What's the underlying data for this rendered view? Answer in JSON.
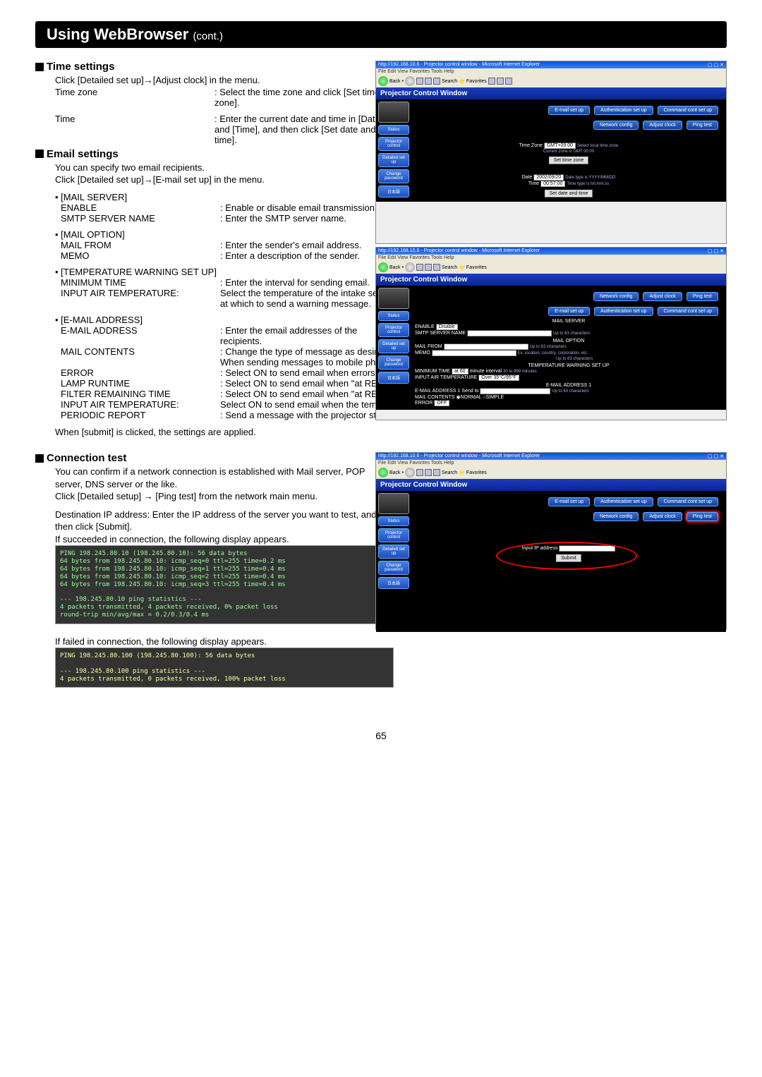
{
  "title": "Using WebBrowser",
  "title_cont": "(cont.)",
  "s1": {
    "heading": "Time settings",
    "intro": "Click [Detailed set up]→[Adjust clock] in the menu.",
    "timezone_lbl": "Time zone",
    "timezone_desc": ": Select the time zone and click [Set time zone].",
    "time_lbl": "Time",
    "time_desc": ": Enter the current date and time in [Date] and [Time], and then click [Set date and time]."
  },
  "s2": {
    "heading": "Email settings",
    "line1": "You can specify two email recipients.",
    "line2": "Click [Detailed set up]→[E-mail set up] in the menu.",
    "mail_server": "• [MAIL SERVER]",
    "enable_lbl": "ENABLE",
    "enable_desc": ": Enable or disable email transmission.",
    "smtp_lbl": "SMTP SERVER NAME",
    "smtp_desc": ": Enter the SMTP server name.",
    "mail_option": "• [MAIL OPTION]",
    "mailfrom_lbl": "MAIL FROM",
    "mailfrom_desc": ": Enter the sender's email address.",
    "memo_lbl": "MEMO",
    "memo_desc": ": Enter a description of the sender.",
    "temp_warn": "• [TEMPERATURE WARNING SET UP]",
    "mintime_lbl": "MINIMUM TIME",
    "mintime_desc": ": Enter the interval for sending email.",
    "inair_lbl": "INPUT AIR TEMPERATURE:",
    "inair_desc": "Select the temperature of the intake sensor at which to send a warning message.",
    "email_addr": "• [E-MAIL ADDRESS]",
    "ea_lbl": "E-MAIL ADDRESS",
    "ea_desc": ": Enter the email addresses of the recipients.",
    "mc_lbl": "MAIL CONTENTS",
    "mc_desc": ": Change the type of message as desired.",
    "mc_desc2": "When sending messages to mobile phones, select \"SIMPLE.\"",
    "err_lbl": "ERROR",
    "err_desc": ": Select ON to send email when errors occur.",
    "lamp_lbl": "LAMP RUNTIME",
    "lamp_desc": ": Select ON to send email when \"at REMAIN\" is reached.",
    "fr_lbl": "FILTER REMAINING TIME",
    "fr_desc": ": Select ON to send email when \"at REMAIN\" is reached.",
    "iat_lbl": "INPUT AIR TEMPERATURE:",
    "iat_desc": "Select ON to send email when the temperature set in [TEMPERATURE WARNING SET UP] is exceeded.",
    "pr_lbl": "PERIODIC REPORT",
    "pr_desc": ": Send a message with the projector status at the selected date and time.",
    "submit": "When [submit] is clicked, the settings are applied."
  },
  "s3": {
    "heading": "Connection test",
    "l1": "You can confirm if a network connection is established with Mail server, POP server, DNS server or the like.",
    "l2": "Click [Detailed setup] → [Ping test] from the network main menu.",
    "l3": "Destination IP address: Enter the IP address of the server you want to test, and then click [Submit].",
    "l4": "If succeeded in connection, the following display appears.",
    "l5": "If failed in connection, the following display appears.",
    "ping_ok": "PING 198.245.80.10 (198.245.80.10): 56 data bytes\n64 bytes from 198.245.80.10: icmp_seq=0 ttl=255 time=0.2 ms\n64 bytes from 198.245.80.10: icmp_seq=1 ttl=255 time=0.4 ms\n64 bytes from 198.245.80.10: icmp_seq=2 ttl=255 time=0.4 ms\n64 bytes from 198.245.80.10: icmp_seq=3 ttl=255 time=0.4 ms\n\n--- 198.245.80.10 ping statistics ---\n4 packets transmitted, 4 packets received, 0% packet loss\nround-trip min/avg/max = 0.2/0.3/0.4 ms",
    "ping_fail": "PING 198.245.80.100 (198.245.80.100): 56 data bytes\n\n--- 198.245.80.100 ping statistics ---\n4 packets transmitted, 0 packets received, 100% packet loss"
  },
  "shots": {
    "ie_title": "http://192.168.10.6 - Projector control window - Microsoft Internet Explorer",
    "ie_menu": "File  Edit  View  Favorites  Tools  Help",
    "back": "Back",
    "search": "Search",
    "fav": "Favorites",
    "pcw": "Projector Control Window",
    "email_setup": "E-mail set up",
    "auth_setup": "Authentication set up",
    "cmd_setup": "Command cont set up",
    "adjust_clock": "Adjust clock",
    "net_config": "Network config",
    "ping": "Ping test",
    "status": "Status",
    "proj_ctrl": "Projector control",
    "det_setup": "Detailed set up",
    "chg_pass": "Change password",
    "jp": "日本語",
    "tz_lbl": "Time Zone",
    "tz_val": "GMT+09:00",
    "tz_btn": "Set time zone",
    "tz_hint": "Select local time zone",
    "tz_hint2": "Current zone is GMT 00:00",
    "date_lbl": "Date",
    "date_val": "2002/09/20",
    "date_hint": "Date type is YYYY/MM/DD",
    "time_lbl": "Time",
    "time_val": "00:57:00",
    "time_hint": "Time type is hh:mm:ss",
    "dt_btn": "Set date and time",
    "ms_head": "MAIL SERVER",
    "enable": "ENABLE",
    "disable": "Disable",
    "ssn": "SMTP SERVER NAME",
    "ssn_hint": "Up to 63 characters",
    "mo_head": "MAIL OPTION",
    "mf": "MAIL FROM",
    "mf_hint": "Up to 63 characters",
    "memo": "MEMO",
    "memo_hint": "Ex. location, country, corporation, etc.",
    "memo_hint2": "Up to 63 characters",
    "tw_head": "TEMPERATURE WARNING SET UP",
    "mt": "MINIMUM TIME",
    "mt_val": "at 60",
    "mt_unit": "minute interval",
    "mt_hint": "30 to 999 minutes",
    "iat": "INPUT AIR TEMPERATURE",
    "iat_val": "Over 35°C/95°F",
    "ea_head": "E-MAIL ADDRESS 1",
    "ea": "E-MAIL ADDRESS 1",
    "ea_sendto": "Send to",
    "ea_hint": "Up to 63 characters",
    "mcs": "MAIL CONTENTS",
    "normal": "NORMAL",
    "simple": "SIMPLE",
    "error": "ERROR",
    "off": "OFF",
    "ipaddr": "Input IP address",
    "submit_btn": "Submit"
  },
  "pagenum": "65"
}
